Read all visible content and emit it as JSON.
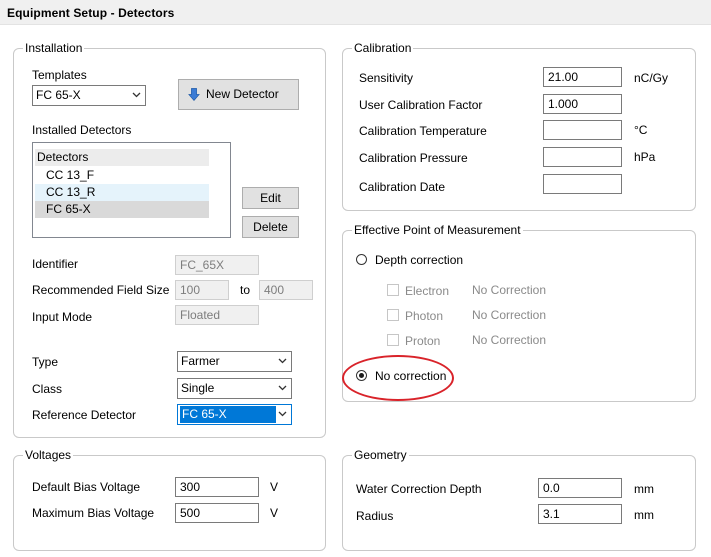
{
  "window": {
    "title": "Equipment Setup - Detectors"
  },
  "installation": {
    "legend": "Installation",
    "templates_label": "Templates",
    "template_value": "FC 65-X",
    "new_detector_label": "New Detector",
    "installed_label": "Installed Detectors",
    "list_header": "Detectors",
    "detectors": [
      "CC 13_F",
      "CC 13_R",
      "FC 65-X"
    ],
    "edit_label": "Edit",
    "delete_label": "Delete",
    "identifier_label": "Identifier",
    "identifier_value": "FC_65X",
    "field_size_label": "Recommended Field Size",
    "field_size_from": "100",
    "field_size_to_label": "to",
    "field_size_to": "400",
    "input_mode_label": "Input Mode",
    "input_mode_value": "Floated",
    "type_label": "Type",
    "type_value": "Farmer",
    "class_label": "Class",
    "class_value": "Single",
    "reference_label": "Reference Detector",
    "reference_value": "FC 65-X"
  },
  "calibration": {
    "legend": "Calibration",
    "sensitivity_label": "Sensitivity",
    "sensitivity_value": "21.00",
    "sensitivity_unit": "nC/Gy",
    "ucf_label": "User Calibration Factor",
    "ucf_value": "1.000",
    "temp_label": "Calibration Temperature",
    "temp_value": "",
    "temp_unit": "°C",
    "pressure_label": "Calibration Pressure",
    "pressure_value": "",
    "pressure_unit": "hPa",
    "date_label": "Calibration Date",
    "date_value": ""
  },
  "epom": {
    "legend": "Effective Point of Measurement",
    "depth_correction_label": "Depth correction",
    "electron_label": "Electron",
    "electron_value": "No Correction",
    "photon_label": "Photon",
    "photon_value": "No Correction",
    "proton_label": "Proton",
    "proton_value": "No Correction",
    "no_correction_label": "No correction",
    "selected": "No correction"
  },
  "voltages": {
    "legend": "Voltages",
    "default_label": "Default Bias Voltage",
    "default_value": "300",
    "default_unit": "V",
    "max_label": "Maximum Bias Voltage",
    "max_value": "500",
    "max_unit": "V"
  },
  "geometry": {
    "legend": "Geometry",
    "wcd_label": "Water Correction Depth",
    "wcd_value": "0.0",
    "wcd_unit": "mm",
    "radius_label": "Radius",
    "radius_value": "3.1",
    "radius_unit": "mm"
  },
  "colors": {
    "selection": "#0078d7",
    "annotation_circle": "#d9232a",
    "new_detector_icon": "#3a7bd5"
  },
  "icons": {
    "new_detector": "arrow-down-icon",
    "dropdown": "chevron-down-icon"
  }
}
